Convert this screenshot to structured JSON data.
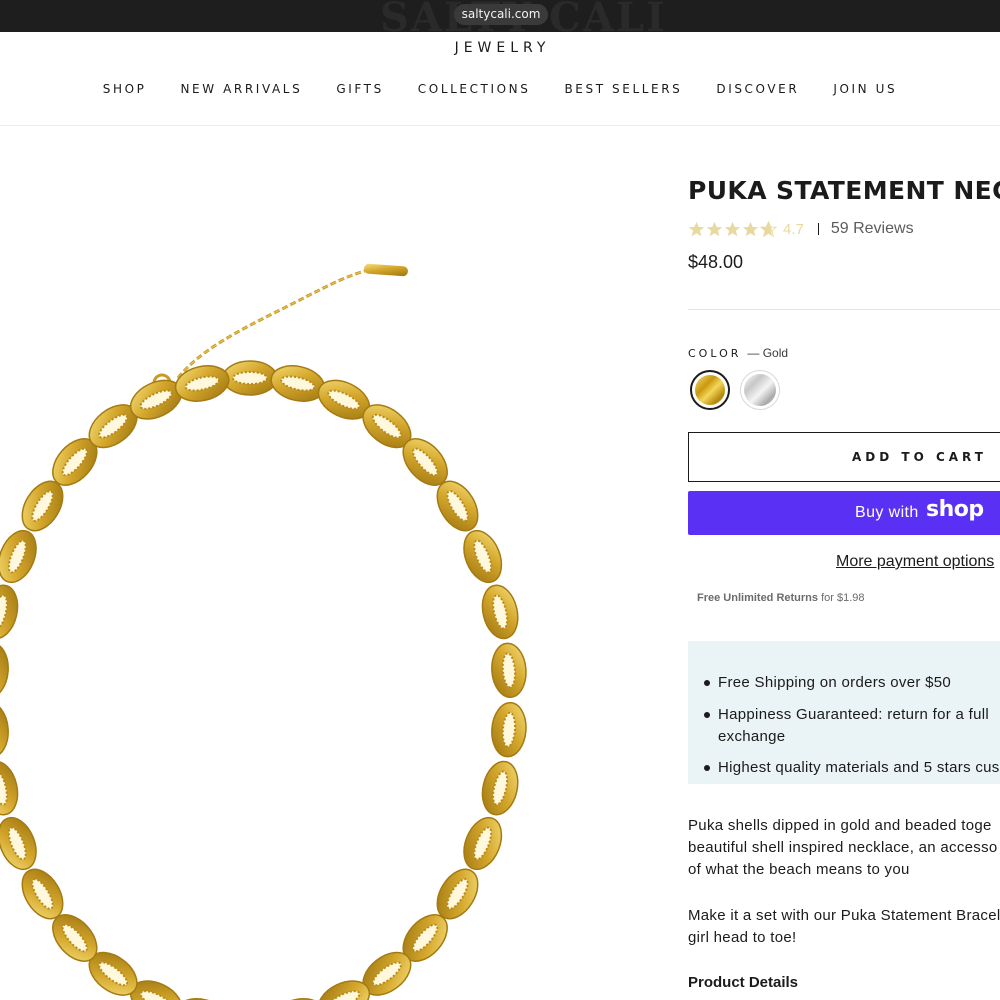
{
  "browser": {
    "url": "saltycali.com"
  },
  "header": {
    "brand_watermark": "SALTY CALI",
    "brand_sub": "JEWELRY",
    "nav": [
      "SHOP",
      "NEW ARRIVALS",
      "GIFTS",
      "COLLECTIONS",
      "BEST SELLERS",
      "DISCOVER",
      "JOIN US"
    ]
  },
  "product": {
    "title": "PUKA STATEMENT NECKLACE",
    "rating": 4.7,
    "rating_text": "4.7",
    "reviews": "59 Reviews",
    "price": "$48.00",
    "color_label": "COLOR",
    "color_value": "— Gold",
    "swatches": [
      {
        "name": "Gold",
        "selected": true
      },
      {
        "name": "Silver",
        "selected": false
      }
    ],
    "add_to_cart": "ADD TO CART",
    "buy_with": "Buy with",
    "shop_logo": "shop",
    "more_payment": "More payment options",
    "returns_bold": "Free Unlimited Returns",
    "returns_rest": "for $1.98",
    "perks": [
      "Free Shipping on orders over $50",
      "Happiness Guaranteed: return for a full",
      "exchange",
      "Highest quality materials and 5 stars cus"
    ],
    "description": [
      "Puka shells dipped in gold and beaded toge",
      "beautiful shell inspired necklace, an accesso",
      "of what the beach means to you"
    ],
    "set_text": [
      "Make it a set with our Puka Statement Bracel",
      "girl head to toe!"
    ],
    "details_title": "Product Details"
  },
  "colors": {
    "star": "#e8d9a0",
    "shop_purple": "#5a31f4",
    "perks_bg": "#eaf3f6",
    "gold": "#d4a72c"
  }
}
